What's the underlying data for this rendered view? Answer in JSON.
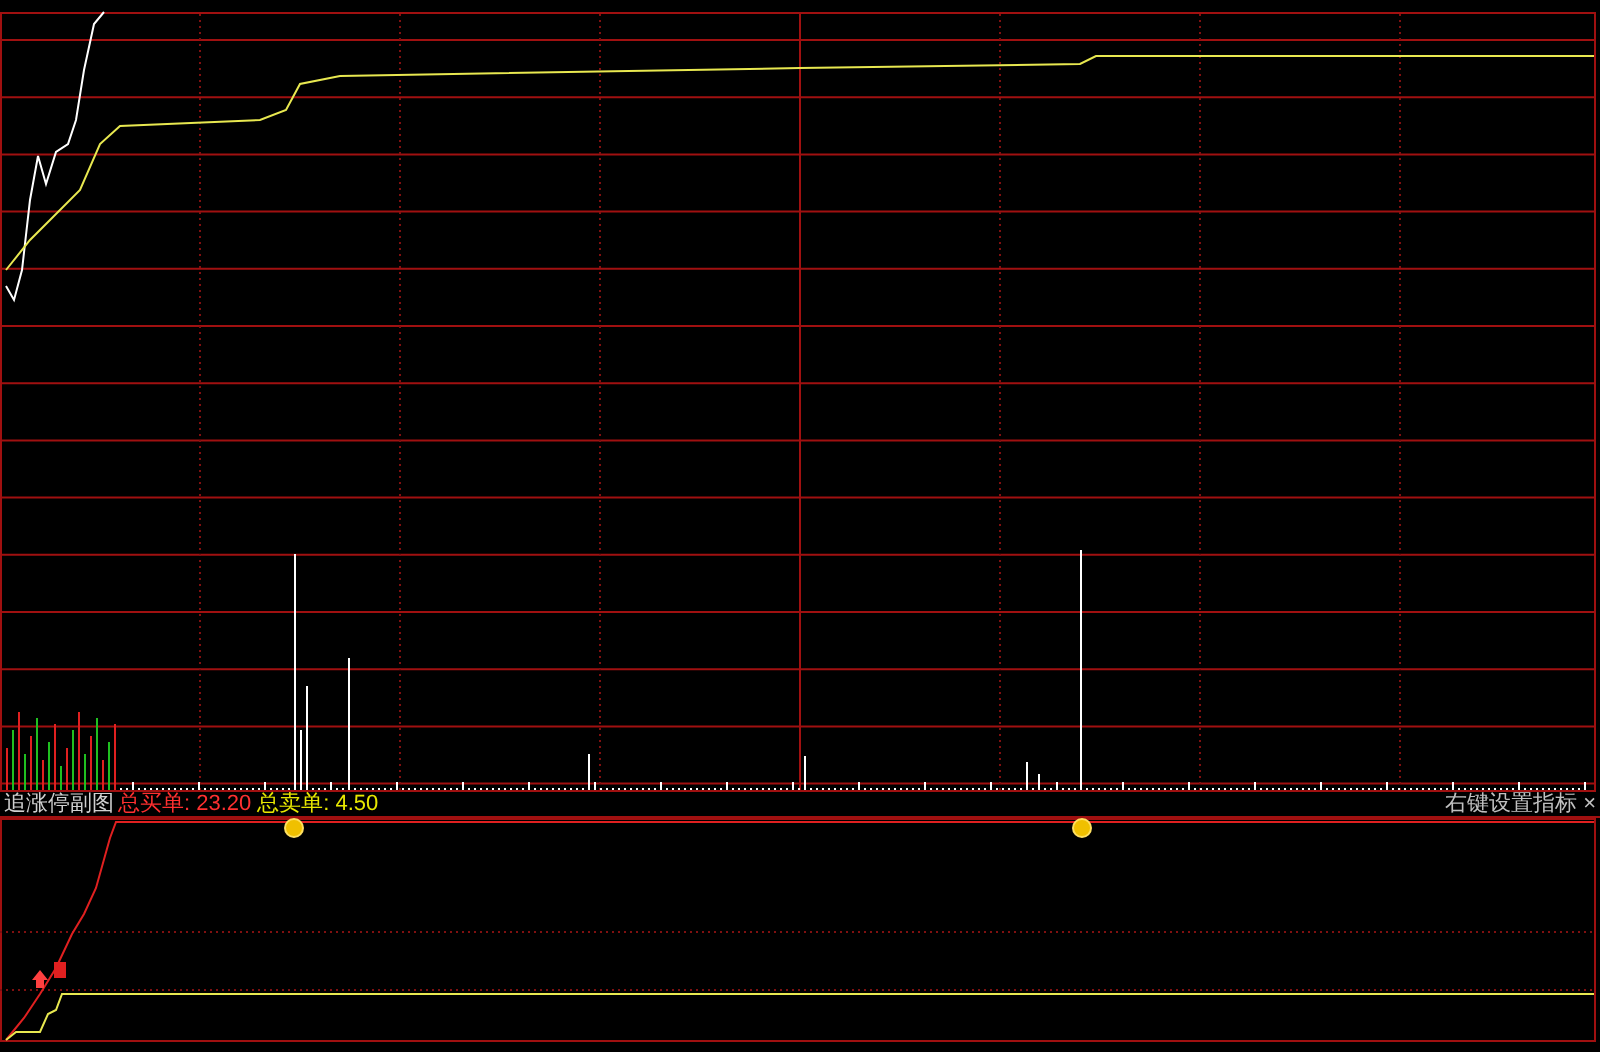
{
  "indicator": {
    "name": "追涨停副图",
    "stats": [
      {
        "label": "总买单:",
        "value": "23.20",
        "kind": "buy"
      },
      {
        "label": "总卖单:",
        "value": "4.50",
        "kind": "sell"
      }
    ],
    "hint": "右键设置指标",
    "close": "×"
  }
}
